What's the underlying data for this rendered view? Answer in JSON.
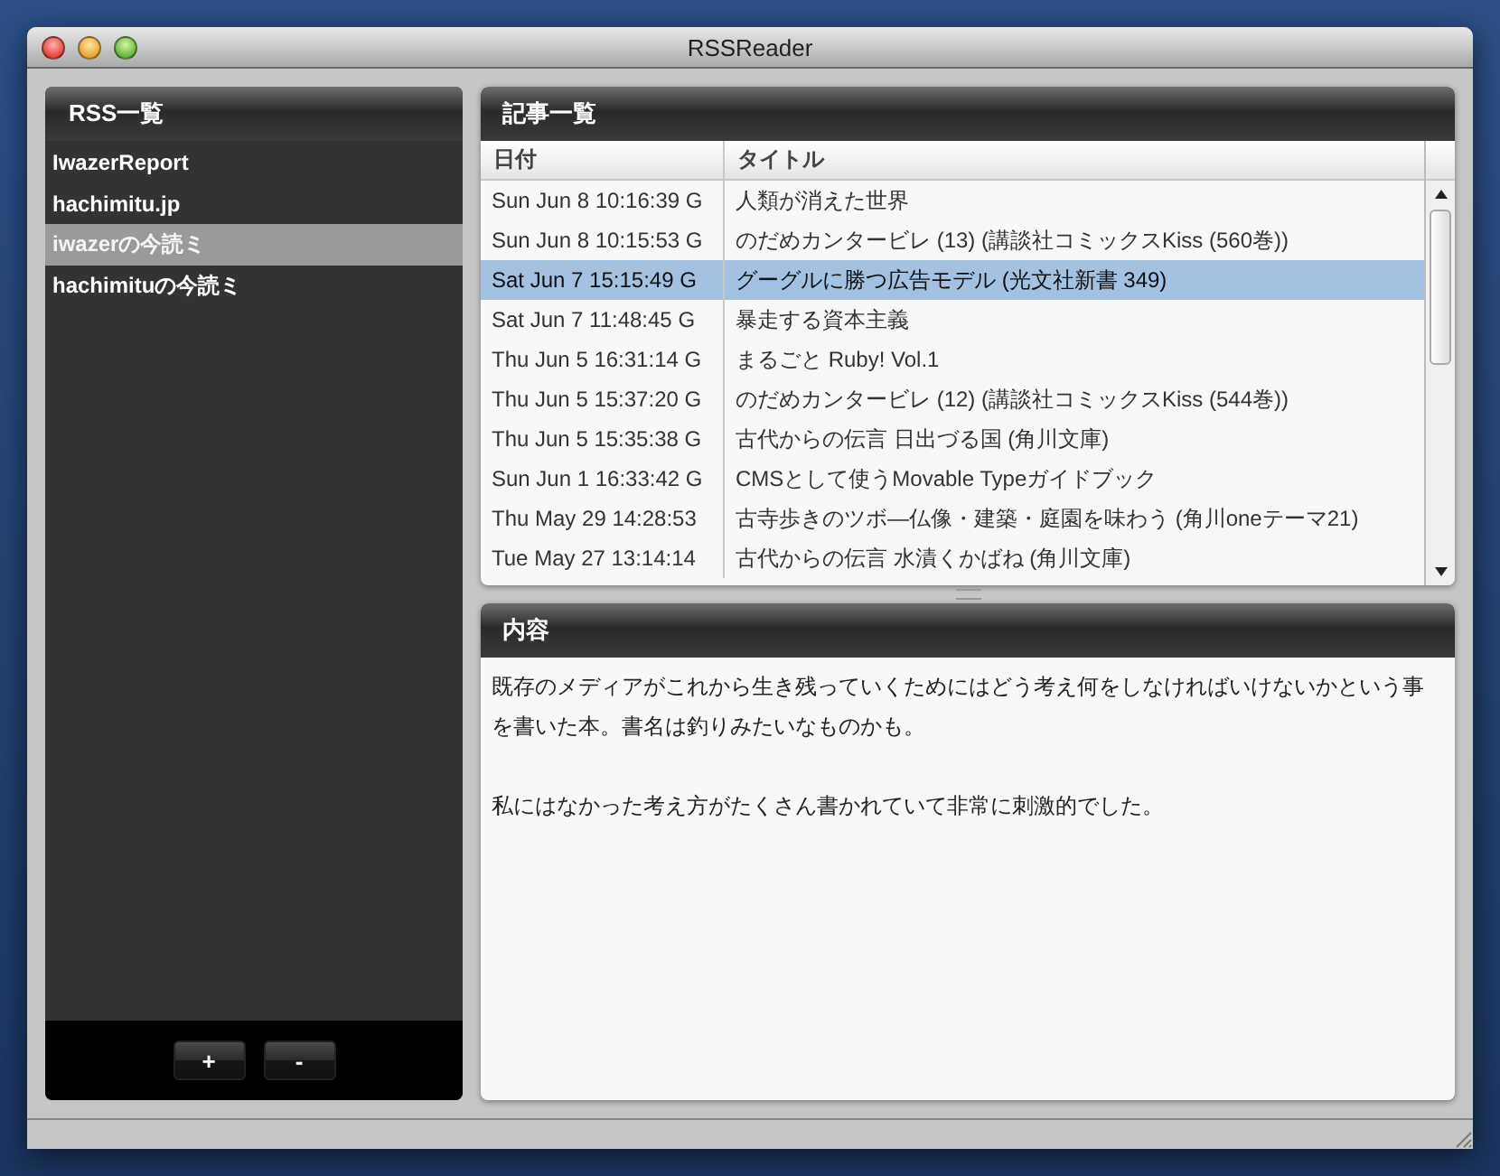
{
  "window": {
    "title": "RSSReader"
  },
  "feeds": {
    "title": "RSS一覧",
    "items": [
      {
        "label": "IwazerReport",
        "selected": false
      },
      {
        "label": "hachimitu.jp",
        "selected": false
      },
      {
        "label": "iwazerの今読ミ",
        "selected": true
      },
      {
        "label": "hachimituの今読ミ",
        "selected": false
      }
    ],
    "buttons": [
      "+",
      "-"
    ]
  },
  "articles": {
    "title": "記事一覧",
    "columns": [
      "日付",
      "タイトル"
    ],
    "rows": [
      {
        "date": "Sun Jun 8 10:16:39 G",
        "title": "人類が消えた世界",
        "selected": false
      },
      {
        "date": "Sun Jun 8 10:15:53 G",
        "title": "のだめカンタービレ (13) (講談社コミックスKiss (560巻))",
        "selected": false
      },
      {
        "date": "Sat Jun 7 15:15:49 G",
        "title": "グーグルに勝つ広告モデル (光文社新書 349)",
        "selected": true
      },
      {
        "date": "Sat Jun 7 11:48:45 G",
        "title": "暴走する資本主義",
        "selected": false
      },
      {
        "date": "Thu Jun 5 16:31:14 G",
        "title": "まるごと Ruby! Vol.1",
        "selected": false
      },
      {
        "date": "Thu Jun 5 15:37:20 G",
        "title": "のだめカンタービレ (12) (講談社コミックスKiss (544巻))",
        "selected": false
      },
      {
        "date": "Thu Jun 5 15:35:38 G",
        "title": "古代からの伝言 日出づる国 (角川文庫)",
        "selected": false
      },
      {
        "date": "Sun Jun 1 16:33:42 G",
        "title": "CMSとして使うMovable Typeガイドブック",
        "selected": false
      },
      {
        "date": "Thu May 29 14:28:53",
        "title": "古寺歩きのツボ―仏像・建築・庭園を味わう (角川oneテーマ21)",
        "selected": false
      },
      {
        "date": "Tue May 27 13:14:14",
        "title": "古代からの伝言 水漬くかばね (角川文庫)",
        "selected": false
      }
    ]
  },
  "content": {
    "title": "内容",
    "paragraphs": [
      "既存のメディアがこれから生き残っていくためにはどう考え何をしなければいけないかという事を書いた本。書名は釣りみたいなものかも。",
      "私にはなかった考え方がたくさん書かれていて非常に刺激的でした。"
    ]
  }
}
